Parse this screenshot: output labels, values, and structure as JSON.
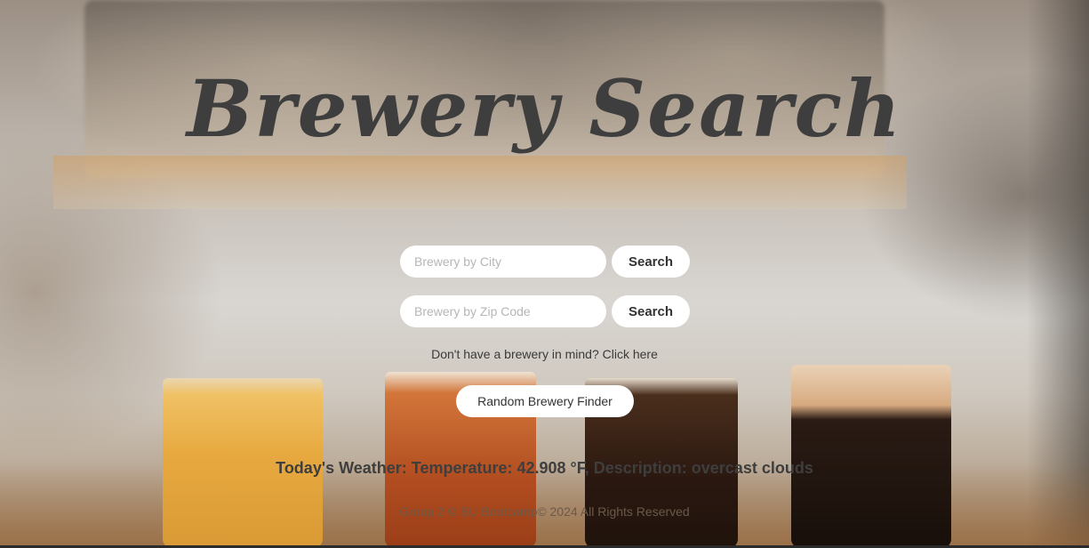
{
  "header": {
    "title": "Brewery Search"
  },
  "search": {
    "city_placeholder": "Brewery by City",
    "city_button": "Search",
    "zip_placeholder": "Brewery by Zip Code",
    "zip_button": "Search"
  },
  "random": {
    "hint": "Don't have a brewery in mind? Click here",
    "button": "Random Brewery Finder"
  },
  "weather": {
    "text": "Today's Weather: Temperature: 42.908 °F, Description: overcast clouds"
  },
  "footer": {
    "text": "Group 2 © BU Bootcamp© 2024 All Rights Reserved"
  }
}
